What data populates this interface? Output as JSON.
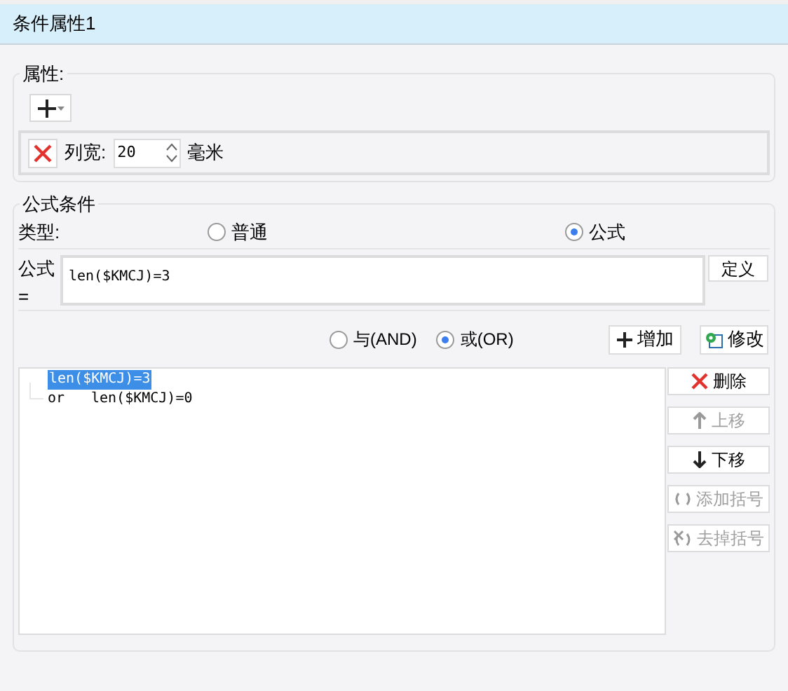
{
  "title": "条件属性1",
  "properties": {
    "legend": "属性:",
    "rows": [
      {
        "label": "列宽:",
        "value": "20",
        "unit": "毫米"
      }
    ]
  },
  "formula_condition": {
    "legend": "公式条件",
    "type_label": "类型:",
    "types": [
      {
        "label": "普通",
        "selected": false
      },
      {
        "label": "公式",
        "selected": true
      }
    ],
    "formula_label": "公式=",
    "formula": "len($KMCJ)=3",
    "define_button": "定义",
    "logic": [
      {
        "label": "与(AND)",
        "selected": false
      },
      {
        "label": "或(OR)",
        "selected": true
      }
    ],
    "add_button": "增加",
    "modify_button": "修改",
    "conditions": [
      {
        "text": "len($KMCJ)=3",
        "selected": true
      },
      {
        "connector": "or",
        "text": "len($KMCJ)=0",
        "selected": false
      }
    ],
    "actions": [
      {
        "kind": "delete",
        "label": "删除",
        "disabled": false
      },
      {
        "kind": "up",
        "label": "上移",
        "disabled": true
      },
      {
        "kind": "down",
        "label": "下移",
        "disabled": false
      },
      {
        "kind": "add_parens",
        "label": "添加括号",
        "disabled": true
      },
      {
        "kind": "remove_parens",
        "label": "去掉括号",
        "disabled": true
      }
    ]
  }
}
